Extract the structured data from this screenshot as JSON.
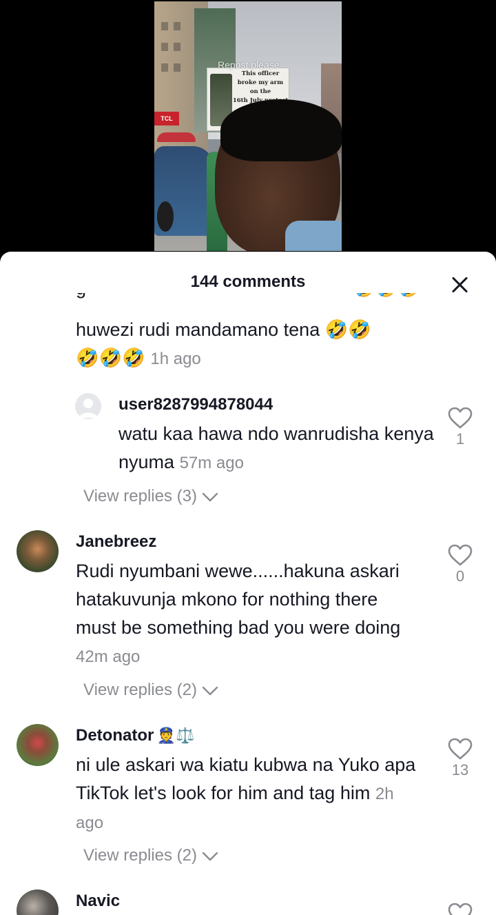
{
  "video": {
    "overlay_text": "Repost please",
    "sign_text": "This officer\nbroke my arm\non the\n16th July protest",
    "store_sign": "TCL"
  },
  "sheet": {
    "title": "144 comments",
    "close_icon": "close-icon"
  },
  "comments": [
    {
      "text": "huwezi rudi mandamano tena 🤣🤣",
      "text2": "🤣🤣🤣",
      "time": "1h ago"
    },
    {
      "user": "user8287994878044",
      "text": "watu kaa hawa ndo wanrudisha kenya nyuma",
      "time": "57m ago",
      "likes": "1",
      "view_replies": "View replies (3)"
    },
    {
      "user": "Janebreez",
      "text": "Rudi nyumbani wewe......hakuna askari hatakuvunja mkono for nothing there must be something bad you were doing",
      "time": "42m ago",
      "likes": "0",
      "view_replies": "View replies (2)"
    },
    {
      "user": "Detonator",
      "user_emoji": "👮⚖️",
      "text": "ni ule askari wa kiatu kubwa na Yuko apa TikTok let's look for him and tag him",
      "time": "2h ago",
      "likes": "13",
      "view_replies": "View replies (2)"
    },
    {
      "user": "Navic"
    }
  ],
  "colors": {
    "text": "#161823",
    "muted": "#8a8b91",
    "sheet_bg": "#ffffff"
  }
}
